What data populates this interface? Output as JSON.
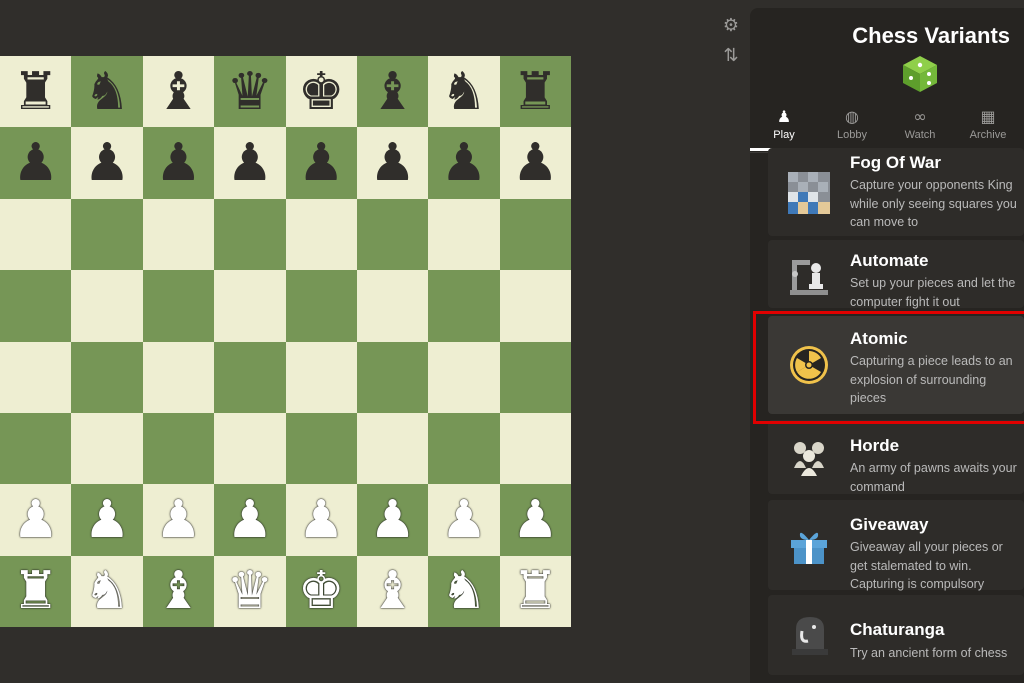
{
  "board": {
    "ranks": [
      [
        "♜",
        "♞",
        "♝",
        "♛",
        "♚",
        "♝",
        "♞",
        "♜"
      ],
      [
        "♟",
        "♟",
        "♟",
        "♟",
        "♟",
        "♟",
        "♟",
        "♟"
      ],
      [
        "",
        "",
        "",
        "",
        "",
        "",
        "",
        ""
      ],
      [
        "",
        "",
        "",
        "",
        "",
        "",
        "",
        ""
      ],
      [
        "",
        "",
        "",
        "",
        "",
        "",
        "",
        ""
      ],
      [
        "",
        "",
        "",
        "",
        "",
        "",
        "",
        ""
      ],
      [
        "♙",
        "♙",
        "♙",
        "♙",
        "♙",
        "♙",
        "♙",
        "♙"
      ],
      [
        "♖",
        "♘",
        "♗",
        "♕",
        "♔",
        "♗",
        "♘",
        "♖"
      ]
    ],
    "light_color": "#eeeed2",
    "dark_color": "#769656"
  },
  "side_controls": {
    "settings_icon": "gear-icon",
    "flip_icon": "flip-board-icon"
  },
  "panel": {
    "title": "Chess Variants",
    "tabs": [
      {
        "label": "Play",
        "icon": "pawn-icon",
        "active": true
      },
      {
        "label": "Lobby",
        "icon": "globe-icon",
        "active": false
      },
      {
        "label": "Watch",
        "icon": "binoculars-icon",
        "active": false
      },
      {
        "label": "Archive",
        "icon": "clapperboard-icon",
        "active": false
      }
    ],
    "variants": [
      {
        "title": "Fog Of War",
        "description": "Capture your opponents King while only seeing squares you can move to",
        "icon": "fog-board-icon"
      },
      {
        "title": "Automate",
        "description": "Set up your pieces and let the computer fight it out",
        "icon": "robot-arm-icon"
      },
      {
        "title": "Atomic",
        "description": "Capturing a piece leads to an explosion of surrounding pieces",
        "icon": "radiation-icon",
        "selected": true
      },
      {
        "title": "Horde",
        "description": "An army of pawns awaits your command",
        "icon": "pawns-icon"
      },
      {
        "title": "Giveaway",
        "description": "Giveaway all your pieces or get stalemated to win. Capturing is compulsory",
        "icon": "gift-icon"
      },
      {
        "title": "Chaturanga",
        "description": "Try an ancient form of chess",
        "icon": "elephant-piece-icon"
      }
    ]
  },
  "colors": {
    "background": "#302e2b",
    "panel": "#262421",
    "card": "#2e2c29",
    "highlight": "#e10000"
  }
}
